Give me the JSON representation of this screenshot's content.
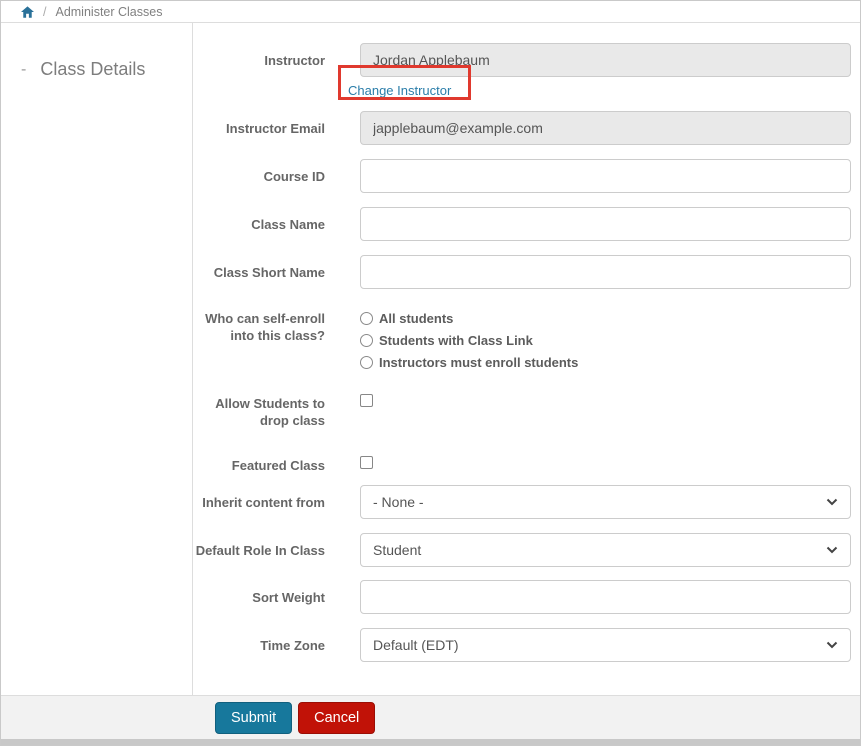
{
  "breadcrumb": {
    "separator": "/",
    "current": "Administer Classes"
  },
  "sidebar": {
    "collapse_indicator": "-",
    "title": "Class Details"
  },
  "form": {
    "instructor": {
      "label": "Instructor",
      "value": "Jordan Applebaum",
      "change_link": "Change Instructor"
    },
    "instructor_email": {
      "label": "Instructor Email",
      "value": "japplebaum@example.com"
    },
    "course_id": {
      "label": "Course ID",
      "value": ""
    },
    "class_name": {
      "label": "Class Name",
      "value": ""
    },
    "class_short_name": {
      "label": "Class Short Name",
      "value": ""
    },
    "self_enroll": {
      "label": "Who can self-enroll into this class?",
      "options": [
        "All students",
        "Students with Class Link",
        "Instructors must enroll students"
      ]
    },
    "allow_drop": {
      "label": "Allow Students to drop class",
      "checked": false
    },
    "featured_class": {
      "label": "Featured Class",
      "checked": false
    },
    "inherit_content": {
      "label": "Inherit content from",
      "value": "- None -"
    },
    "default_role": {
      "label": "Default Role In Class",
      "value": "Student"
    },
    "sort_weight": {
      "label": "Sort Weight",
      "value": ""
    },
    "time_zone": {
      "label": "Time Zone",
      "value": "Default (EDT)"
    }
  },
  "footer": {
    "submit_label": "Submit",
    "cancel_label": "Cancel"
  },
  "colors": {
    "accent_teal": "#17789c",
    "cancel_red": "#c11207",
    "link_blue": "#2a7da9",
    "annotation_red": "#e0392e",
    "home_icon_blue": "#2a7199"
  }
}
